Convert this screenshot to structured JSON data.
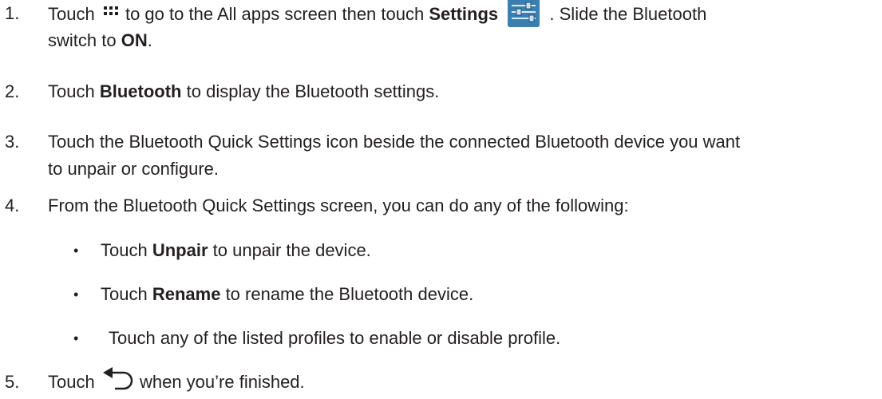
{
  "steps": [
    {
      "number": "1.",
      "p1": "Touch",
      "p2": "to go to the All apps screen then touch",
      "p3": "Settings",
      "p4": ". Slide the Bluetooth",
      "p5": "switch to",
      "p6": "ON",
      "p7": "."
    },
    {
      "number": "2.",
      "p1": "Touch",
      "p2": "Bluetooth",
      "p3": "to display the Bluetooth settings."
    },
    {
      "number": "3.",
      "line1": "Touch the Bluetooth Quick Settings icon beside the connected Bluetooth device you want",
      "line2": "to unpair or configure."
    },
    {
      "number": "4.",
      "text": "From the Bluetooth Quick Settings screen, you can do any of the following:"
    },
    {
      "number": "5.",
      "p1": "Touch",
      "p2": "when you’re finished."
    }
  ],
  "sub_items": [
    {
      "bullet": "•",
      "p1": "Touch",
      "p2": "Unpair",
      "p3": "to unpair the device."
    },
    {
      "bullet": "•",
      "p1": "Touch",
      "p2": "Rename",
      "p3": "to rename the Bluetooth device."
    },
    {
      "bullet": "•",
      "p1": "Touch any of the listed profiles to enable or disable profile."
    }
  ],
  "icons": {
    "all_apps": "all-apps-grid-icon",
    "settings": "settings-sliders-icon",
    "back": "back-arrow-icon"
  },
  "colors": {
    "text": "#231f20",
    "settings_icon_bg": "#3a7fb2"
  }
}
